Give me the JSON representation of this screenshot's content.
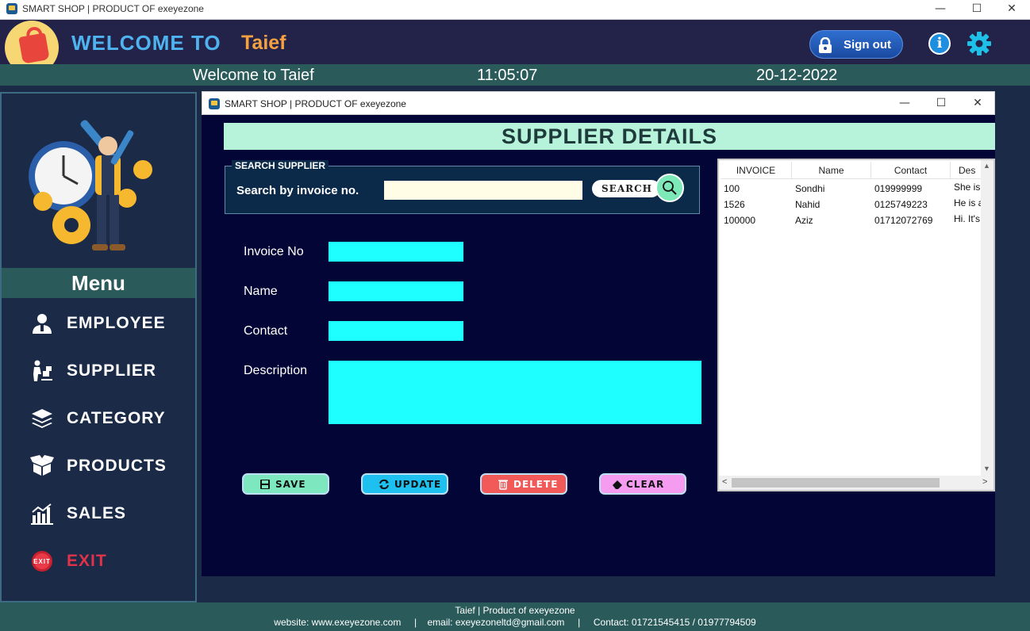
{
  "window": {
    "title": "SMART SHOP | PRODUCT OF exeyezone",
    "minimize": "—",
    "maximize": "☐",
    "close": "✕"
  },
  "header": {
    "welcome": "WELCOME TO",
    "user": "Taief",
    "signout_label": "Sign out",
    "info_glyph": "i"
  },
  "strip": {
    "greeting": "Welcome to Taief",
    "time": "11:05:07",
    "date": "20-12-2022"
  },
  "sidebar": {
    "menu_title": "Menu",
    "items": [
      {
        "label": "EMPLOYEE",
        "icon": "employee-icon"
      },
      {
        "label": "SUPPLIER",
        "icon": "supplier-icon"
      },
      {
        "label": "CATEGORY",
        "icon": "category-icon"
      },
      {
        "label": "PRODUCTS",
        "icon": "products-icon"
      },
      {
        "label": "SALES",
        "icon": "sales-icon"
      },
      {
        "label": "EXIT",
        "icon": "exit-icon"
      }
    ]
  },
  "child_window": {
    "title": "SMART SHOP | PRODUCT OF exeyezone",
    "banner": "SUPPLIER DETAILS",
    "search": {
      "legend": "SEARCH SUPPLIER",
      "label": "Search by invoice no.",
      "value": "",
      "button": "SEARCH"
    },
    "form": {
      "invoice_label": "Invoice No",
      "name_label": "Name",
      "contact_label": "Contact",
      "description_label": "Description",
      "invoice_value": "",
      "name_value": "",
      "contact_value": "",
      "description_value": ""
    },
    "buttons": {
      "save": "SAVE",
      "update": "UPDATE",
      "delete": "DELETE",
      "clear": "CLEAR"
    },
    "table": {
      "columns": [
        "INVOICE",
        "Name",
        "Contact",
        "Des"
      ],
      "rows": [
        [
          "100",
          "Sondhi",
          "019999999",
          "She is a"
        ],
        [
          "1526",
          "Nahid",
          "0125749223",
          "He is a"
        ],
        [
          "100000",
          "Aziz",
          "01712072769",
          "Hi. It's"
        ]
      ]
    }
  },
  "footer": {
    "line1": "Taief | Product of exeyezone",
    "line2": "website: www.exeyezone.com     |    email: exeyezoneltd@gmail.com     |     Contact: 01721545415 / 01977794509"
  },
  "colors": {
    "header_bg": "#23234a",
    "strip_bg": "#2a5a5a",
    "child_bg": "#020536",
    "field_bg": "#1effff",
    "accent_blue": "#4fb3f0",
    "accent_orange": "#f5a142",
    "exit_red": "#e0334a"
  }
}
